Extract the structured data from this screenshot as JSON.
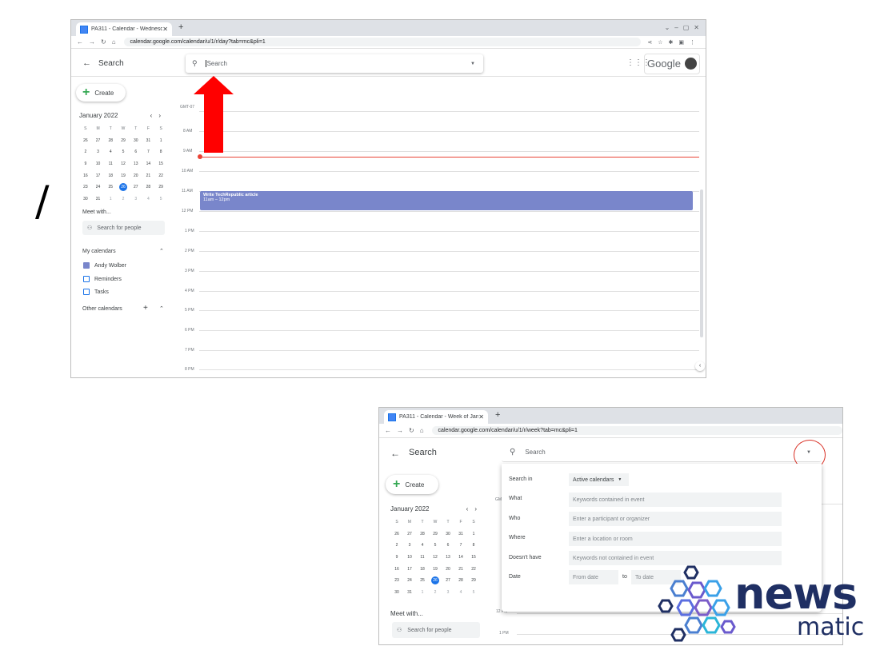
{
  "separator": "/",
  "top": {
    "tab_title": "PA311 - Calendar - Wednesday,",
    "url": "calendar.google.com/calendar/u/1/r/day?tab=mc&pli=1",
    "search_title": "Search",
    "search_placeholder": "Search",
    "brand": "Google",
    "create_label": "Create",
    "month_title": "January 2022",
    "weekdays": [
      "S",
      "M",
      "T",
      "W",
      "T",
      "F",
      "S"
    ],
    "weeks": [
      [
        "26",
        "27",
        "28",
        "29",
        "30",
        "31",
        "1"
      ],
      [
        "2",
        "3",
        "4",
        "5",
        "6",
        "7",
        "8"
      ],
      [
        "9",
        "10",
        "11",
        "12",
        "13",
        "14",
        "15"
      ],
      [
        "16",
        "17",
        "18",
        "19",
        "20",
        "21",
        "22"
      ],
      [
        "23",
        "24",
        "25",
        "26",
        "27",
        "28",
        "29"
      ],
      [
        "30",
        "31",
        "1",
        "2",
        "3",
        "4",
        "5"
      ]
    ],
    "today": "26",
    "meet_with": "Meet with...",
    "search_people": "Search for people",
    "my_calendars": "My calendars",
    "calendars": [
      {
        "name": "Andy Wolber",
        "checked": true
      },
      {
        "name": "Reminders",
        "checked": false
      },
      {
        "name": "Tasks",
        "checked": false
      }
    ],
    "other_calendars": "Other calendars",
    "timezone": "GMT-07",
    "hours": [
      "8 AM",
      "9 AM",
      "10 AM",
      "11 AM",
      "12 PM",
      "1 PM",
      "2 PM",
      "3 PM",
      "4 PM",
      "5 PM",
      "6 PM",
      "7 PM",
      "8 PM"
    ],
    "event_title": "Write TechRepublic article",
    "event_time": "11am – 12pm",
    "arrow_color": "#ff0000"
  },
  "bottom": {
    "tab_title": "PA311 - Calendar - Week of Janu",
    "url": "calendar.google.com/calendar/u/1/r/week?tab=mc&pli=1",
    "search_title": "Search",
    "search_placeholder": "Search",
    "create_label": "Create",
    "month_title": "January 2022",
    "meet_with": "Meet with...",
    "search_people": "Search for people",
    "gmt_partial": "GM",
    "time_12": "12 PM",
    "time_1": "1 PM",
    "re_partial": "Re",
    "search_options": {
      "search_in_label": "Search in",
      "search_in_value": "Active calendars",
      "what_label": "What",
      "what_placeholder": "Keywords contained in event",
      "who_label": "Who",
      "who_placeholder": "Enter a participant or organizer",
      "where_label": "Where",
      "where_placeholder": "Enter a location or room",
      "doesnt_have_label": "Doesn't have",
      "doesnt_have_placeholder": "Keywords not contained in event",
      "date_label": "Date",
      "from_placeholder": "From date",
      "to_label": "to",
      "to_placeholder": "To date"
    }
  },
  "watermark": {
    "line1": "news",
    "line2": "matic",
    "color": "#1f2f63"
  }
}
